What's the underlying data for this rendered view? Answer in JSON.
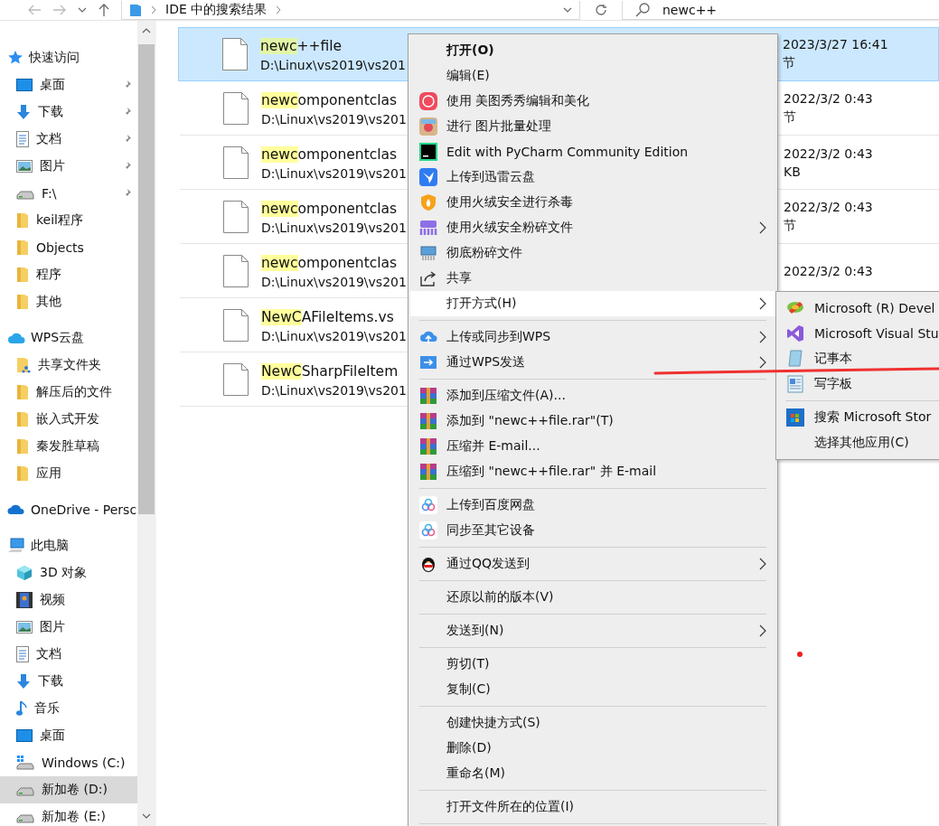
{
  "toolbar": {
    "address": {
      "crumbs": [
        "IDE 中的搜索结果"
      ]
    },
    "search": {
      "value": "newc++"
    }
  },
  "sidebar": {
    "groups": [
      {
        "label": "快速访问",
        "children": [
          {
            "label": "桌面",
            "pinned": true,
            "selected": false
          },
          {
            "label": "下载",
            "pinned": true,
            "selected": false
          },
          {
            "label": "文档",
            "pinned": true,
            "selected": false
          },
          {
            "label": "图片",
            "pinned": true,
            "selected": false
          },
          {
            "label": "F:\\",
            "pinned": true,
            "selected": false
          },
          {
            "label": "keil程序",
            "pinned": false,
            "selected": false
          },
          {
            "label": "Objects",
            "pinned": false,
            "selected": false
          },
          {
            "label": "程序",
            "pinned": false,
            "selected": false
          },
          {
            "label": "其他",
            "pinned": false,
            "selected": false
          }
        ]
      },
      {
        "label": "WPS云盘",
        "children": [
          {
            "label": "共享文件夹",
            "pinned": false,
            "selected": false
          },
          {
            "label": "解压后的文件",
            "pinned": false,
            "selected": false
          },
          {
            "label": "嵌入式开发",
            "pinned": false,
            "selected": false
          },
          {
            "label": "秦发胜草稿",
            "pinned": false,
            "selected": false
          },
          {
            "label": "应用",
            "pinned": false,
            "selected": false
          }
        ]
      },
      {
        "label": "OneDrive - Persc"
      },
      {
        "label": "此电脑",
        "children": [
          {
            "label": "3D 对象",
            "pinned": false,
            "selected": false
          },
          {
            "label": "视频",
            "pinned": false,
            "selected": false
          },
          {
            "label": "图片",
            "pinned": false,
            "selected": false
          },
          {
            "label": "文档",
            "pinned": false,
            "selected": false
          },
          {
            "label": "下载",
            "pinned": false,
            "selected": false
          },
          {
            "label": "音乐",
            "pinned": false,
            "selected": false
          },
          {
            "label": "桌面",
            "pinned": false,
            "selected": false
          },
          {
            "label": "Windows (C:)",
            "pinned": false,
            "selected": false
          },
          {
            "label": "新加卷 (D:)",
            "pinned": false,
            "selected": true
          },
          {
            "label": "新加卷 (E:)",
            "pinned": false,
            "selected": false
          }
        ]
      }
    ]
  },
  "files": [
    {
      "match": "newc",
      "rest": "++file",
      "path": "D:\\Linux\\vs2019\\vs201",
      "date": "2023/3/27 16:41",
      "size": "节",
      "selected": true
    },
    {
      "match": "newc",
      "rest": "omponentclas",
      "path": "D:\\Linux\\vs2019\\vs201",
      "date": "2022/3/2 0:43",
      "size": "节",
      "selected": false
    },
    {
      "match": "newc",
      "rest": "omponentclas",
      "path": "D:\\Linux\\vs2019\\vs201",
      "date": "2022/3/2 0:43",
      "size": "KB",
      "selected": false
    },
    {
      "match": "newc",
      "rest": "omponentclas",
      "path": "D:\\Linux\\vs2019\\vs201",
      "date": "2022/3/2 0:43",
      "size": "节",
      "selected": false
    },
    {
      "match": "newc",
      "rest": "omponentclas",
      "path": "D:\\Linux\\vs2019\\vs201",
      "date": "2022/3/2 0:43",
      "selected": false
    },
    {
      "match": "NewC",
      "rest": "AFileItems.vs",
      "path": "D:\\Linux\\vs2019\\vs201",
      "selected": false
    },
    {
      "match": "NewC",
      "rest": "SharpFileItem",
      "path": "D:\\Linux\\vs2019\\vs201",
      "selected": false
    }
  ],
  "context_menu": {
    "groups": [
      [
        {
          "label": "打开(O)",
          "bold": true,
          "submenu": false,
          "selected": false
        },
        {
          "label": "编辑(E)",
          "bold": false,
          "submenu": false,
          "selected": false
        },
        {
          "label": "使用 美图秀秀编辑和美化",
          "bold": false,
          "submenu": false,
          "selected": false
        },
        {
          "label": "进行 图片批量处理",
          "bold": false,
          "submenu": false,
          "selected": false
        },
        {
          "label": "Edit with PyCharm Community Edition",
          "bold": false,
          "submenu": false,
          "selected": false
        },
        {
          "label": "上传到迅雷云盘",
          "bold": false,
          "submenu": false,
          "selected": false
        },
        {
          "label": "使用火绒安全进行杀毒",
          "bold": false,
          "submenu": false,
          "selected": false
        },
        {
          "label": "使用火绒安全粉碎文件",
          "bold": false,
          "submenu": true,
          "selected": false
        },
        {
          "label": "彻底粉碎文件",
          "bold": false,
          "submenu": false,
          "selected": false
        },
        {
          "label": "共享",
          "bold": false,
          "submenu": false,
          "selected": false
        },
        {
          "label": "打开方式(H)",
          "bold": false,
          "submenu": true,
          "selected": true
        }
      ],
      [
        {
          "label": "上传或同步到WPS",
          "bold": false,
          "submenu": true,
          "selected": false
        },
        {
          "label": "通过WPS发送",
          "bold": false,
          "submenu": true,
          "selected": false
        }
      ],
      [
        {
          "label": "添加到压缩文件(A)...",
          "bold": false,
          "submenu": false,
          "selected": false
        },
        {
          "label": "添加到 \"newc++file.rar\"(T)",
          "bold": false,
          "submenu": false,
          "selected": false
        },
        {
          "label": "压缩并 E-mail...",
          "bold": false,
          "submenu": false,
          "selected": false
        },
        {
          "label": "压缩到 \"newc++file.rar\" 并 E-mail",
          "bold": false,
          "submenu": false,
          "selected": false
        }
      ],
      [
        {
          "label": "上传到百度网盘",
          "bold": false,
          "submenu": false,
          "selected": false
        },
        {
          "label": "同步至其它设备",
          "bold": false,
          "submenu": false,
          "selected": false
        }
      ],
      [
        {
          "label": "通过QQ发送到",
          "bold": false,
          "submenu": true,
          "selected": false
        }
      ],
      [
        {
          "label": "还原以前的版本(V)",
          "bold": false,
          "submenu": false,
          "selected": false
        }
      ],
      [
        {
          "label": "发送到(N)",
          "bold": false,
          "submenu": true,
          "selected": false
        }
      ],
      [
        {
          "label": "剪切(T)",
          "bold": false,
          "submenu": false,
          "selected": false
        },
        {
          "label": "复制(C)",
          "bold": false,
          "submenu": false,
          "selected": false
        }
      ],
      [
        {
          "label": "创建快捷方式(S)",
          "bold": false,
          "submenu": false,
          "selected": false
        },
        {
          "label": "删除(D)",
          "bold": false,
          "submenu": false,
          "selected": false
        },
        {
          "label": "重命名(M)",
          "bold": false,
          "submenu": false,
          "selected": false
        }
      ],
      [
        {
          "label": "打开文件所在的位置(I)",
          "bold": false,
          "submenu": false,
          "selected": false
        }
      ]
    ]
  },
  "open_with_menu": {
    "groups": [
      [
        {
          "label": "Microsoft (R) Devel"
        },
        {
          "label": "Microsoft Visual Stu"
        },
        {
          "label": "记事本"
        },
        {
          "label": "写字板"
        }
      ],
      [
        {
          "label": "搜索 Microsoft Stor"
        },
        {
          "label": "选择其他应用(C)"
        }
      ]
    ]
  }
}
